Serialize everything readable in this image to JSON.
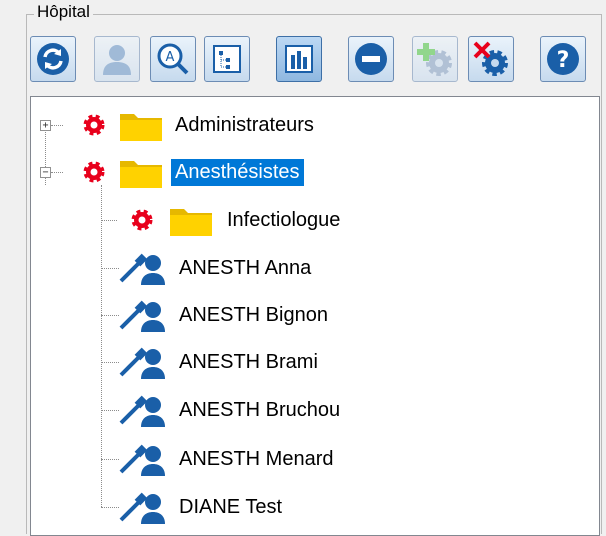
{
  "group": {
    "title": "Hôpital"
  },
  "toolbar": {
    "buttons": [
      {
        "name": "refresh-button",
        "icon": "refresh-icon",
        "state": "normal"
      },
      {
        "name": "user-button",
        "icon": "user-icon",
        "state": "disabled"
      },
      {
        "name": "search-button",
        "icon": "search-icon",
        "state": "normal"
      },
      {
        "name": "tree-view-button",
        "icon": "tree-icon",
        "state": "normal"
      },
      {
        "name": "org-chart-button",
        "icon": "org-chart-icon",
        "state": "active"
      },
      {
        "name": "remove-button",
        "icon": "minus-circle-icon",
        "state": "normal"
      },
      {
        "name": "add-service-button",
        "icon": "add-gear-icon",
        "state": "disabled"
      },
      {
        "name": "delete-service-button",
        "icon": "delete-gear-icon",
        "state": "normal"
      },
      {
        "name": "help-button",
        "icon": "help-icon",
        "state": "normal"
      }
    ]
  },
  "tree": {
    "nodes": [
      {
        "label": "Administrateurs",
        "type": "group",
        "expander": "+",
        "selected": false
      },
      {
        "label": "Anesthésistes",
        "type": "group",
        "expander": "−",
        "selected": true
      },
      {
        "label": "Infectiologue",
        "type": "subgroup",
        "selected": false
      },
      {
        "label": "ANESTH Anna",
        "type": "user",
        "selected": false
      },
      {
        "label": "ANESTH Bignon",
        "type": "user",
        "selected": false
      },
      {
        "label": "ANESTH Brami",
        "type": "user",
        "selected": false
      },
      {
        "label": "ANESTH Bruchou",
        "type": "user",
        "selected": false
      },
      {
        "label": "ANESTH Menard",
        "type": "user",
        "selected": false
      },
      {
        "label": "DIANE Test",
        "type": "user",
        "selected": false
      }
    ]
  },
  "colors": {
    "selection": "#0078d7",
    "folder": "#ffd200",
    "gear_red": "#e8001c",
    "icon_blue": "#1a5fa8"
  }
}
